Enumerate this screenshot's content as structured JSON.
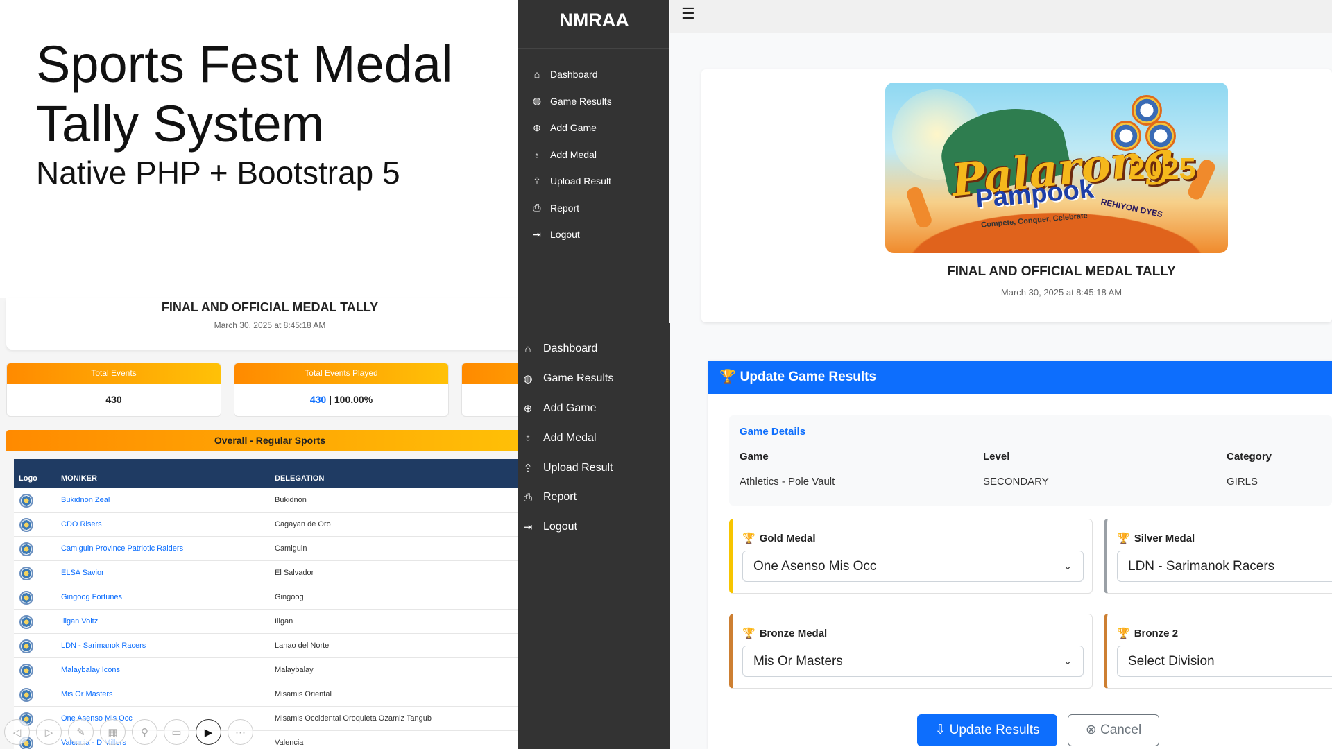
{
  "slide": {
    "title": "Sports Fest Medal Tally System",
    "subtitle": "Native PHP + Bootstrap 5"
  },
  "tally": {
    "title": "FINAL AND OFFICIAL MEDAL TALLY",
    "date": "March 30, 2025 at 8:45:18 AM",
    "stats": [
      {
        "label": "Total Events",
        "value": "430"
      },
      {
        "label": "Total Events Played",
        "link": "430",
        "rest": " | 100.00%"
      }
    ],
    "overall_title": "Overall - Regular Sports",
    "columns": [
      "Logo",
      "MONIKER",
      "DELEGATION"
    ],
    "rows": [
      {
        "moniker": "Bukidnon Zeal",
        "delegation": "Bukidnon"
      },
      {
        "moniker": "CDO Risers",
        "delegation": "Cagayan de Oro"
      },
      {
        "moniker": "Camiguin Province Patriotic Raiders",
        "delegation": "Camiguin"
      },
      {
        "moniker": "ELSA Savior",
        "delegation": "El Salvador"
      },
      {
        "moniker": "Gingoog Fortunes",
        "delegation": "Gingoog"
      },
      {
        "moniker": "Iligan Voltz",
        "delegation": "Iligan"
      },
      {
        "moniker": "LDN - Sarimanok Racers",
        "delegation": "Lanao del Norte"
      },
      {
        "moniker": "Malaybalay Icons",
        "delegation": "Malaybalay"
      },
      {
        "moniker": "Mis Or Masters",
        "delegation": "Misamis Oriental"
      },
      {
        "moniker": "One Asenso Mis Occ",
        "delegation": "Misamis Occidental Oroquieta Ozamiz Tangub"
      },
      {
        "moniker": "Valencia - D Millers",
        "delegation": "Valencia"
      }
    ]
  },
  "sidebar": {
    "brand": "NMRAA",
    "items": [
      {
        "label": "Dashboard",
        "icon": "home-icon"
      },
      {
        "label": "Game Results",
        "icon": "basketball-icon"
      },
      {
        "label": "Add Game",
        "icon": "plus-circle-icon"
      },
      {
        "label": "Add Medal",
        "icon": "medal-icon"
      },
      {
        "label": "Upload Result",
        "icon": "upload-icon"
      },
      {
        "label": "Report",
        "icon": "printer-icon"
      },
      {
        "label": "Logout",
        "icon": "logout-icon"
      }
    ]
  },
  "main": {
    "banner": {
      "word1": "Palarong",
      "word2": "Pampook",
      "year": "2025",
      "tagline": "Compete, Conquer, Celebrate",
      "region": "REHIYON DYES"
    },
    "title": "FINAL AND OFFICIAL MEDAL TALLY",
    "date": "March 30, 2025 at 8:45:18 AM",
    "form": {
      "header": "Update Game Results",
      "details_heading": "Game Details",
      "labels": {
        "game": "Game",
        "level": "Level",
        "category": "Category"
      },
      "values": {
        "game": "Athletics - Pole Vault",
        "level": "SECONDARY",
        "category": "GIRLS"
      },
      "gold": {
        "label": "Gold Medal",
        "value": "One Asenso Mis Occ"
      },
      "silver": {
        "label": "Silver Medal",
        "value": "LDN - Sarimanok Racers"
      },
      "bronze": {
        "label": "Bronze Medal",
        "value": "Mis Or Masters"
      },
      "bronze2": {
        "label": "Bronze 2",
        "value": "Select Division"
      },
      "update_label": "Update Results",
      "cancel_label": "Cancel"
    }
  },
  "colors": {
    "sidebar_bg": "#333333",
    "primary": "#0d6efd",
    "orange_gradient_start": "#ff8a00",
    "orange_gradient_end": "#ffc107",
    "table_header": "#1f3b63",
    "gold": "#f7c500",
    "silver": "#9aa0a6",
    "bronze": "#cd7f32"
  }
}
